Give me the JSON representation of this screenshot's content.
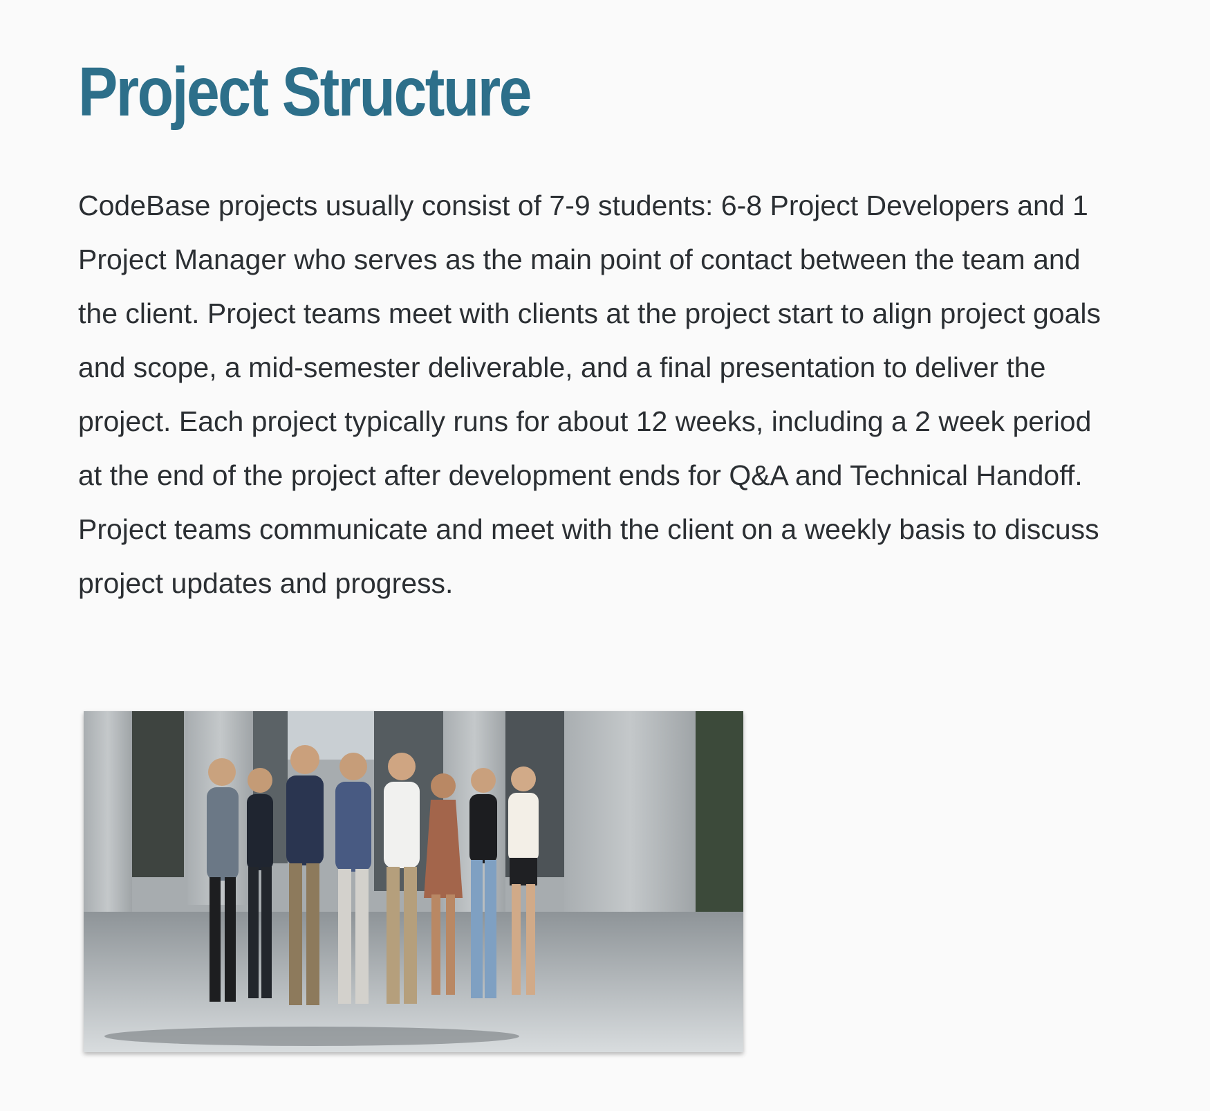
{
  "page": {
    "title": "Project Structure",
    "body": "CodeBase projects usually consist of 7-9 students: 6-8 Project Developers and 1 Project Manager who serves as the main point of contact between the team and the client. Project teams meet with clients at the project start to align project goals and scope, a mid-semester deliverable, and a final presentation to deliver the project. Each project typically runs for about 12 weeks, including a 2 week period at the end of the project after development ends for Q&A and Technical Handoff. Project teams communicate and meet with the client on a weekly basis to discuss project updates and progress."
  },
  "photo": {
    "people_count": 8
  },
  "colors": {
    "title": "#2d6f8a",
    "text": "#2b2f33",
    "background": "#fafafa"
  }
}
